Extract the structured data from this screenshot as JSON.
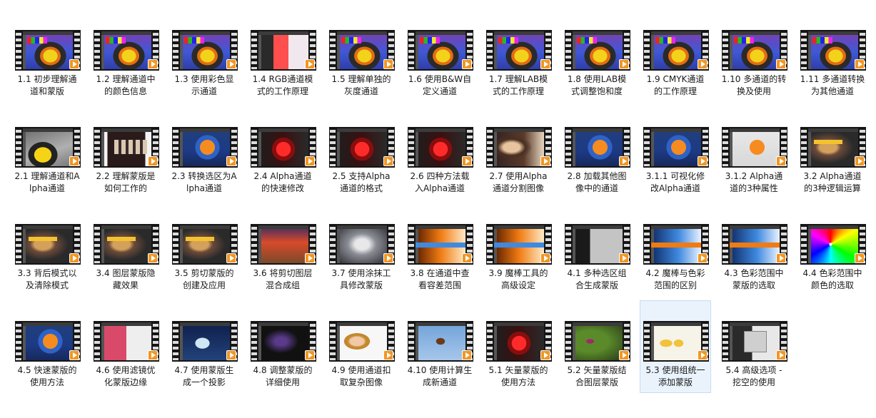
{
  "items": [
    {
      "label": "1.1 初步理解通道和蒙版",
      "thumb": "toucan"
    },
    {
      "label": "1.2 理解通道中的颜色信息",
      "thumb": "toucan"
    },
    {
      "label": "1.3 使用彩色显示通道",
      "thumb": "toucan"
    },
    {
      "label": "1.4 RGB通道模式的工作原理",
      "thumb": "redsquare"
    },
    {
      "label": "1.5 理解单独的灰度通道",
      "thumb": "toucan"
    },
    {
      "label": "1.6 使用B&W自定义通道",
      "thumb": "toucan"
    },
    {
      "label": "1.7 理解LAB模式的工作原理",
      "thumb": "toucan"
    },
    {
      "label": "1.8 使用LAB模式调整饱和度",
      "thumb": "toucan"
    },
    {
      "label": "1.9 CMYK通道的工作原理",
      "thumb": "toucan"
    },
    {
      "label": "1.10 多通道的转换及使用",
      "thumb": "toucan"
    },
    {
      "label": "1.11 多通道转换为其他通道",
      "thumb": "toucan"
    },
    {
      "label": "2.1 理解通道和Alpha通道",
      "thumb": "toucan2"
    },
    {
      "label": "2.2 理解蒙版是如何工作的",
      "thumb": "group"
    },
    {
      "label": "2.3 转换选区为Alpha通道",
      "thumb": "fox"
    },
    {
      "label": "2.4 Alpha通道的快速修改",
      "thumb": "red"
    },
    {
      "label": "2.5 支持Alpha通道的格式",
      "thumb": "red"
    },
    {
      "label": "2.6 四种方法载入Alpha通道",
      "thumb": "red"
    },
    {
      "label": "2.7 使用Alpha通道分割图像",
      "thumb": "portrait"
    },
    {
      "label": "2.8 加载其他图像中的通道",
      "thumb": "fox"
    },
    {
      "label": "3.1.1 可视化修改Alpha通道",
      "thumb": "fox"
    },
    {
      "label": "3.1.2 Alpha通道的3种属性",
      "thumb": "foxlight"
    },
    {
      "label": "3.2 Alpha通道的3种逻辑运算",
      "thumb": "smoke"
    },
    {
      "label": "3.3 背后模式以及清除模式",
      "thumb": "smoke"
    },
    {
      "label": "3.4 图层蒙版隐藏效果",
      "thumb": "smoke"
    },
    {
      "label": "3.5 剪切蒙版的创建及应用",
      "thumb": "smoke"
    },
    {
      "label": "3.6 将剪切图层混合成组",
      "thumb": "room"
    },
    {
      "label": "3.7 使用涂抹工具修改蒙版",
      "thumb": "ghost"
    },
    {
      "label": "3.8 在通道中查看容差范围",
      "thumb": "gradient"
    },
    {
      "label": "3.9 魔棒工具的高级设定",
      "thumb": "gradient"
    },
    {
      "label": "4.1 多种选区组合生成蒙版",
      "thumb": "menu"
    },
    {
      "label": "4.2 魔棒与色彩范围的区别",
      "thumb": "bluegrad"
    },
    {
      "label": "4.3 色彩范围中蒙版的选取",
      "thumb": "bluegrad"
    },
    {
      "label": "4.4 色彩范围中颜色的选取",
      "thumb": "wheel"
    },
    {
      "label": "4.5 快速蒙版的使用方法",
      "thumb": "fox"
    },
    {
      "label": "4.6 使用滤镜优化蒙版边缘",
      "thumb": "pink"
    },
    {
      "label": "4.7 使用蒙版生成一个投影",
      "thumb": "fish"
    },
    {
      "label": "4.8 调整蒙版的详细使用",
      "thumb": "dark"
    },
    {
      "label": "4.9 使用通道扣取复杂图像",
      "thumb": "girl"
    },
    {
      "label": "4.10 使用计算生成新通道",
      "thumb": "bird"
    },
    {
      "label": "5.1 矢量蒙版的使用方法",
      "thumb": "red"
    },
    {
      "label": "5.2 矢量蒙版结合图层蒙版",
      "thumb": "hummer"
    },
    {
      "label": "5.3 使用组统一添加蒙版",
      "thumb": "glass",
      "selected": true
    },
    {
      "label": "5.4 高级选项 - 挖空的使用",
      "thumb": "dialog"
    }
  ]
}
